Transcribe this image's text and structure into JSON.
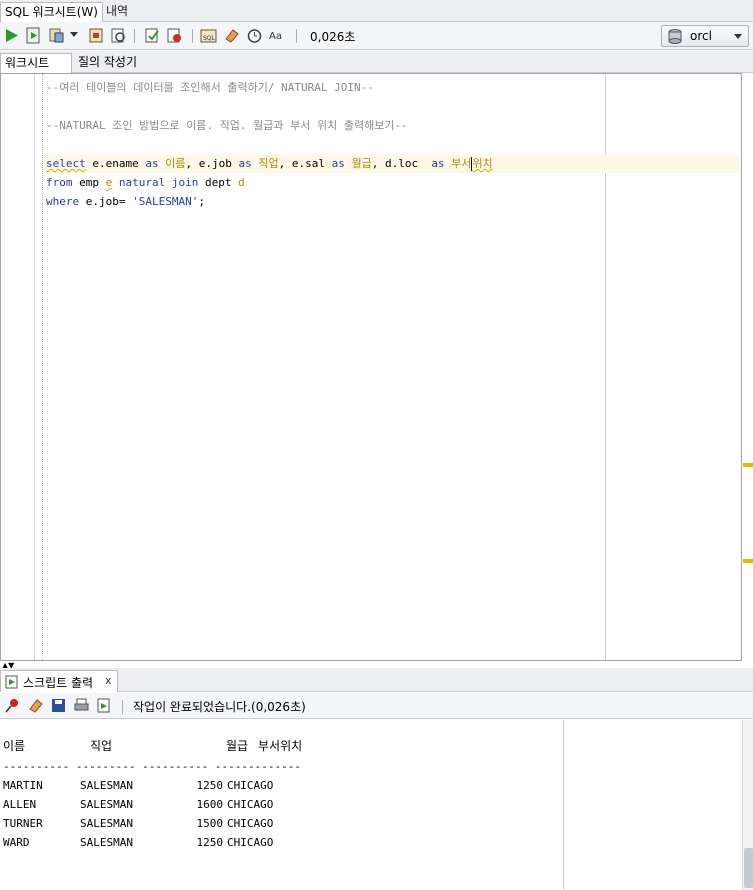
{
  "top_tabs": {
    "worksheet": "SQL 워크시트(W)",
    "history": "내역"
  },
  "toolbar": {
    "elapsed": "0,026초",
    "connection": "orcl"
  },
  "sub_tabs": {
    "worksheet": "워크시트",
    "query_builder": "질의 작성기"
  },
  "editor": {
    "line1": "--여러 테이블의 데이터를 조인해서 출력하기/ NATURAL JOIN--",
    "line2": "--NATURAL 조인 방법으로 이름. 직업. 월급과 부서 위치 출력해보기--",
    "select": {
      "kw_select": "select",
      "c1": " e.ename ",
      "as": "as",
      "a1": "이름",
      "c2": ", e.job ",
      "a2": "직업",
      "c3": ", e.sal ",
      "a3": "월급",
      "c4": ", d.loc  ",
      "a4a": "부서",
      "a4b": "위치"
    },
    "from": {
      "kw_from": "from",
      "t1": " emp ",
      "alias_e": "e",
      "sp": " ",
      "kw_nj": "natural join",
      "t2": " dept ",
      "alias_d": "d"
    },
    "where": {
      "kw_where": "where",
      "cond": " e.job= ",
      "str": "'SALESMAN'",
      "end": ";"
    }
  },
  "output": {
    "tab_label": "스크립트 출력",
    "tab_close": "x",
    "status": "작업이 완료되었습니다.(0,026초)",
    "headers": {
      "name": "이름",
      "job": "직업",
      "sal": "월급",
      "loc": "부서위치"
    },
    "divider": "---------- --------- ---------- -------------",
    "rows": [
      {
        "name": "MARTIN",
        "job": "SALESMAN",
        "sal": "1250",
        "loc": "CHICAGO"
      },
      {
        "name": "ALLEN",
        "job": "SALESMAN",
        "sal": "1600",
        "loc": "CHICAGO"
      },
      {
        "name": "TURNER",
        "job": "SALESMAN",
        "sal": "1500",
        "loc": "CHICAGO"
      },
      {
        "name": "WARD",
        "job": "SALESMAN",
        "sal": "1250",
        "loc": "CHICAGO"
      }
    ]
  }
}
